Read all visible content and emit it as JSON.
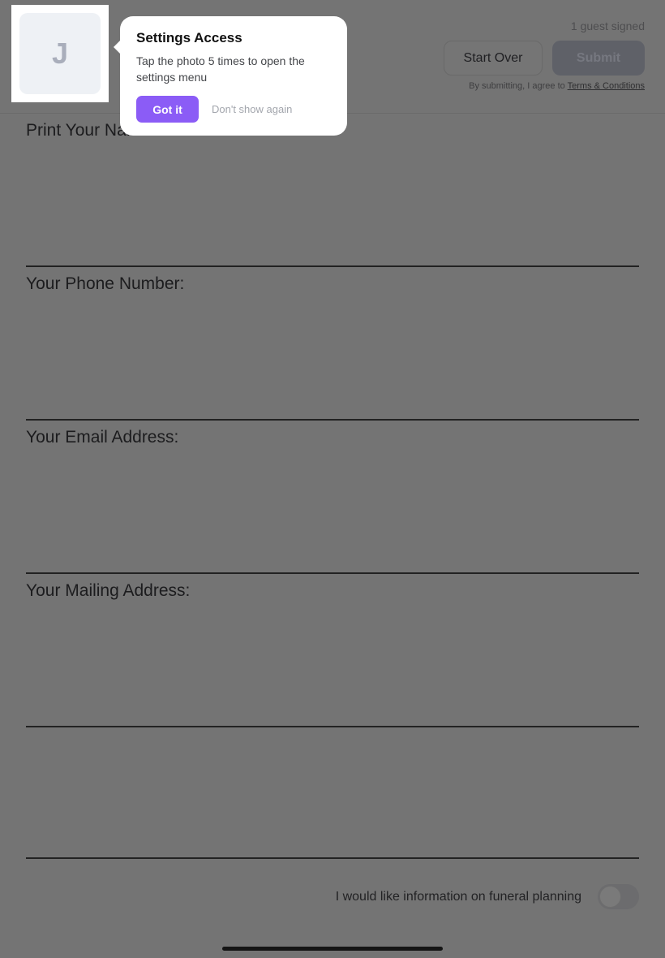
{
  "header": {
    "guest_count": "1 guest signed",
    "start_over_label": "Start Over",
    "submit_label": "Submit",
    "agree_prefix": "By submitting, I agree to ",
    "terms_link": "Terms & Conditions"
  },
  "avatar": {
    "initial": "J"
  },
  "tooltip": {
    "title": "Settings Access",
    "body": "Tap the photo 5 times to open the settings menu",
    "got_it_label": "Got it",
    "dont_show_label": "Don't show again"
  },
  "form": {
    "name_label": "Print Your Name Below:",
    "phone_label": "Your Phone Number:",
    "email_label": "Your Email Address:",
    "mailing_label": "Your Mailing Address:",
    "funeral_info_label": "I would like information on funeral planning",
    "funeral_info_enabled": false
  },
  "colors": {
    "accent": "#8b5cf6",
    "overlay_dim": "#747474"
  },
  "icons": {
    "tooltip_pointer": "caret-left-icon"
  }
}
